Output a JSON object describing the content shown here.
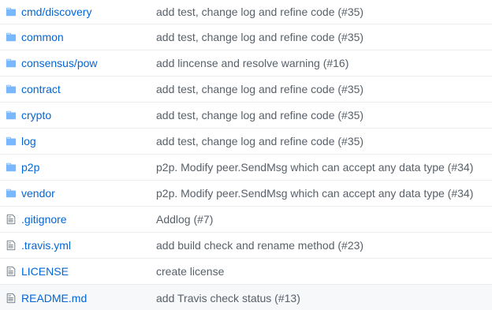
{
  "rows": [
    {
      "type": "dir",
      "icon": "folder-icon",
      "name": "cmd/discovery",
      "message": "add test, change log and refine code (#35)"
    },
    {
      "type": "dir",
      "icon": "folder-icon",
      "name": "common",
      "message": "add test, change log and refine code (#35)"
    },
    {
      "type": "dir",
      "icon": "folder-icon",
      "name": "consensus/pow",
      "message": "add lincense and resolve warning (#16)"
    },
    {
      "type": "dir",
      "icon": "folder-icon",
      "name": "contract",
      "message": "add test, change log and refine code (#35)"
    },
    {
      "type": "dir",
      "icon": "folder-icon",
      "name": "crypto",
      "message": "add test, change log and refine code (#35)"
    },
    {
      "type": "dir",
      "icon": "folder-icon",
      "name": "log",
      "message": "add test, change log and refine code (#35)"
    },
    {
      "type": "dir",
      "icon": "folder-icon",
      "name": "p2p",
      "message": "p2p. Modify peer.SendMsg which can accept any data type (#34)"
    },
    {
      "type": "dir",
      "icon": "folder-icon",
      "name": "vendor",
      "message": "p2p. Modify peer.SendMsg which can accept any data type (#34)"
    },
    {
      "type": "file",
      "icon": "file-icon",
      "name": ".gitignore",
      "message": "Addlog (#7)"
    },
    {
      "type": "file",
      "icon": "file-icon",
      "name": ".travis.yml",
      "message": "add build check and rename method (#23)"
    },
    {
      "type": "file",
      "icon": "file-icon",
      "name": "LICENSE",
      "message": "create license"
    },
    {
      "type": "file",
      "icon": "file-icon",
      "name": "README.md",
      "message": "add Travis check status (#13)"
    }
  ],
  "colors": {
    "link": "#0366d6",
    "message": "#586069",
    "folder_icon": "#79b8ff",
    "file_icon": "#6a737d",
    "border": "#eaecef"
  }
}
